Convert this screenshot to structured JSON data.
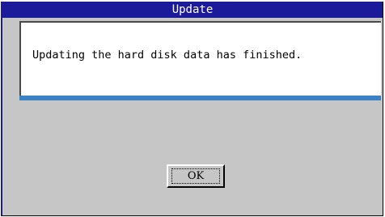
{
  "window": {
    "title": "Update"
  },
  "message": {
    "text": "Updating the hard disk data has finished."
  },
  "buttons": {
    "ok_label": "OK"
  },
  "colors": {
    "titlebar": "#1a1a9a",
    "accent": "#3a82c4",
    "dialog_background": "#c6c6c6"
  }
}
